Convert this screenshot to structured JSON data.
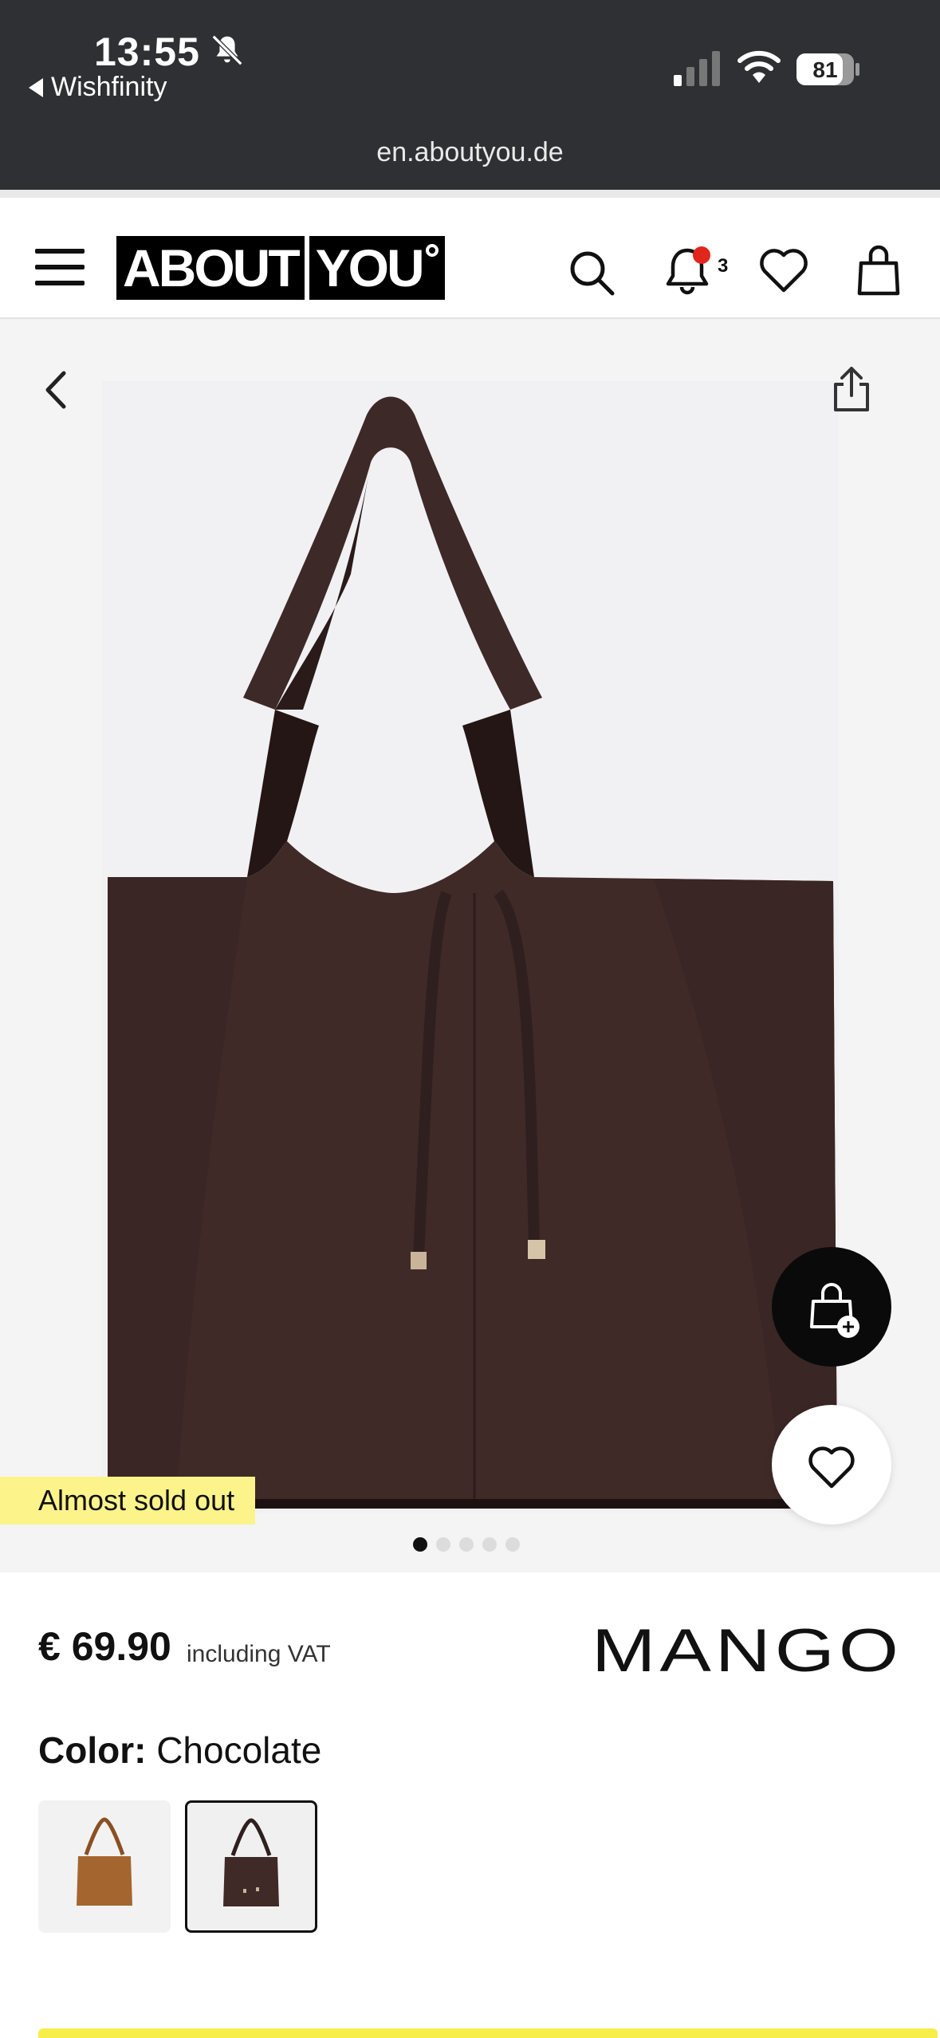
{
  "status_bar": {
    "time": "13:55",
    "back_app_label": "Wishfinity",
    "battery": "81",
    "url": "en.aboutyou.de"
  },
  "header": {
    "logo_part1": "ABOUT",
    "logo_part2": "YOU",
    "notification_count": "3",
    "icons": [
      "menu-icon",
      "search-icon",
      "bell-icon",
      "heart-icon",
      "bag-icon"
    ]
  },
  "gallery": {
    "badge": "Almost sold out",
    "image_count": 5,
    "active_index": 0,
    "product_color_hex": "#3f2a27"
  },
  "product": {
    "price": "€ 69.90",
    "vat_note": "including VAT",
    "brand": "MANGO",
    "color_label": "Color:",
    "color_value": "Chocolate",
    "swatches": [
      {
        "name": "Cognac",
        "hex": "#a5652f",
        "selected": false
      },
      {
        "name": "Chocolate",
        "hex": "#3f2a27",
        "selected": true
      }
    ]
  },
  "colors": {
    "status_bg": "#2e3033",
    "accent_yellow": "#fcf38a",
    "notification_dot": "#e1261c"
  }
}
